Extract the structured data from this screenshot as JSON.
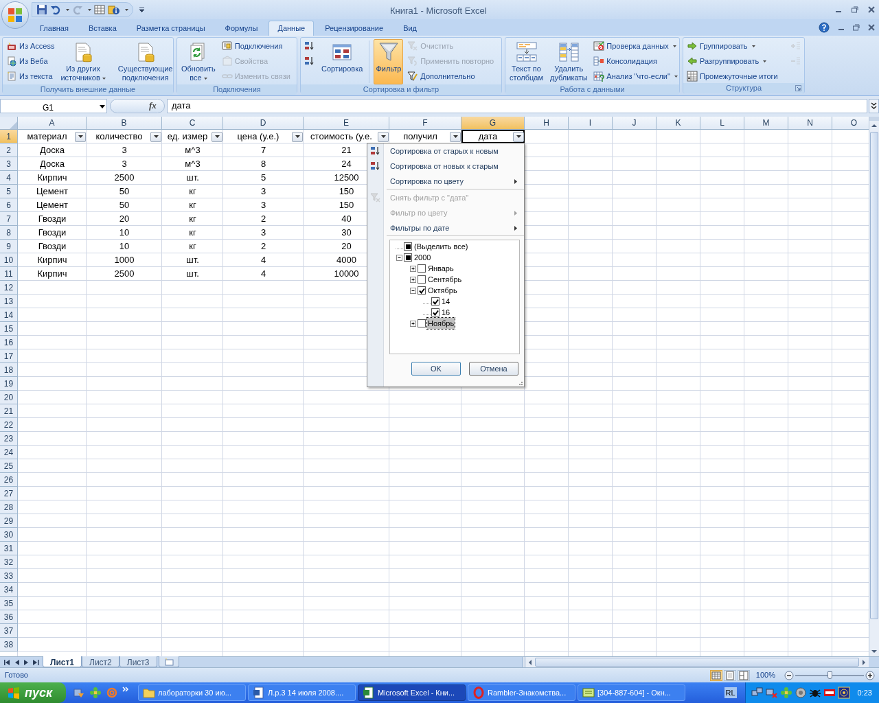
{
  "window": {
    "title": "Книга1 - Microsoft Excel"
  },
  "ribbon_tabs": [
    {
      "label": "Главная",
      "selected": false
    },
    {
      "label": "Вставка",
      "selected": false
    },
    {
      "label": "Разметка страницы",
      "selected": false
    },
    {
      "label": "Формулы",
      "selected": false
    },
    {
      "label": "Данные",
      "selected": true
    },
    {
      "label": "Рецензирование",
      "selected": false
    },
    {
      "label": "Вид",
      "selected": false
    }
  ],
  "ribbon_groups": [
    {
      "label": "Получить внешние данные",
      "launcher": false,
      "columns": [
        {
          "kind": "stack",
          "buttons": [
            {
              "label": "Из Access",
              "disabled": false,
              "dropdown": false
            },
            {
              "label": "Из Веба",
              "disabled": false,
              "dropdown": false
            },
            {
              "label": "Из текста",
              "disabled": false,
              "dropdown": false
            }
          ]
        },
        {
          "kind": "large",
          "label": "Из других\nисточников",
          "disabled": false,
          "dropdown": true,
          "on": false
        },
        {
          "kind": "separator"
        },
        {
          "kind": "large",
          "label": "Существующие\nподключения",
          "disabled": false,
          "dropdown": false,
          "on": false
        }
      ]
    },
    {
      "label": "Подключения",
      "launcher": false,
      "columns": [
        {
          "kind": "large",
          "label": "Обновить\nвсе",
          "disabled": false,
          "dropdown": true,
          "on": false
        },
        {
          "kind": "stack",
          "buttons": [
            {
              "label": "Подключения",
              "disabled": false,
              "dropdown": false
            },
            {
              "label": "Свойства",
              "disabled": true,
              "dropdown": false
            },
            {
              "label": "Изменить связи",
              "disabled": true,
              "dropdown": false
            }
          ]
        }
      ]
    },
    {
      "label": "Сортировка и фильтр",
      "launcher": false,
      "columns": [
        {
          "kind": "stack",
          "buttons": [
            {
              "disabled": false,
              "dropdown": false
            },
            {
              "disabled": false,
              "dropdown": false
            }
          ]
        },
        {
          "kind": "large",
          "label": "Сортировка",
          "disabled": false,
          "dropdown": false,
          "on": false
        },
        {
          "kind": "separator"
        },
        {
          "kind": "large",
          "label": "Фильтр",
          "disabled": false,
          "dropdown": false,
          "on": true
        },
        {
          "kind": "stack",
          "buttons": [
            {
              "label": "Очистить",
              "disabled": true,
              "dropdown": false
            },
            {
              "label": "Применить повторно",
              "disabled": true,
              "dropdown": false
            },
            {
              "label": "Дополнительно",
              "disabled": false,
              "dropdown": false
            }
          ]
        }
      ]
    },
    {
      "label": "Работа с данными",
      "launcher": false,
      "columns": [
        {
          "kind": "large",
          "label": "Текст по\nстолбцам",
          "disabled": false,
          "dropdown": false,
          "on": false
        },
        {
          "kind": "large",
          "label": "Удалить\nдубликаты",
          "disabled": false,
          "dropdown": false,
          "on": false
        },
        {
          "kind": "stack",
          "buttons": [
            {
              "label": "Проверка данных",
              "disabled": false,
              "dropdown": true
            },
            {
              "label": "Консолидация",
              "disabled": false,
              "dropdown": false
            },
            {
              "label": "Анализ \"что-если\"",
              "disabled": false,
              "dropdown": true
            }
          ]
        }
      ]
    },
    {
      "label": "Структура",
      "launcher": true,
      "columns": [
        {
          "kind": "stack",
          "buttons": [
            {
              "label": "Группировать",
              "disabled": false,
              "dropdown": true
            },
            {
              "label": "Разгруппировать",
              "disabled": false,
              "dropdown": true
            },
            {
              "label": "Промежуточные итоги",
              "disabled": false,
              "dropdown": false
            }
          ]
        },
        {
          "kind": "stack",
          "buttons": [
            {
              "disabled": true,
              "dropdown": false
            },
            {
              "disabled": true,
              "dropdown": false
            }
          ]
        }
      ]
    }
  ],
  "formula_bar": {
    "name_box": "G1",
    "function_label": "fx",
    "formula": "дата"
  },
  "sheet": {
    "columns": [
      {
        "label": "A",
        "selected": false
      },
      {
        "label": "B",
        "selected": false
      },
      {
        "label": "C",
        "selected": false
      },
      {
        "label": "D",
        "selected": false
      },
      {
        "label": "E",
        "selected": false
      },
      {
        "label": "F",
        "selected": false
      },
      {
        "label": "G",
        "selected": true
      },
      {
        "label": "H",
        "selected": false
      },
      {
        "label": "I",
        "selected": false
      },
      {
        "label": "J",
        "selected": false
      },
      {
        "label": "K",
        "selected": false
      },
      {
        "label": "L",
        "selected": false
      },
      {
        "label": "M",
        "selected": false
      },
      {
        "label": "N",
        "selected": false
      },
      {
        "label": "O",
        "selected": false
      }
    ],
    "rows": [
      {
        "label": "1",
        "selected": true
      },
      {
        "label": "2",
        "selected": false
      },
      {
        "label": "3",
        "selected": false
      },
      {
        "label": "4",
        "selected": false
      },
      {
        "label": "5",
        "selected": false
      },
      {
        "label": "6",
        "selected": false
      },
      {
        "label": "7",
        "selected": false
      },
      {
        "label": "8",
        "selected": false
      },
      {
        "label": "9",
        "selected": false
      },
      {
        "label": "10",
        "selected": false
      },
      {
        "label": "11",
        "selected": false
      },
      {
        "label": "12",
        "selected": false
      },
      {
        "label": "13",
        "selected": false
      },
      {
        "label": "14",
        "selected": false
      },
      {
        "label": "15",
        "selected": false
      },
      {
        "label": "16",
        "selected": false
      },
      {
        "label": "17",
        "selected": false
      },
      {
        "label": "18",
        "selected": false
      },
      {
        "label": "19",
        "selected": false
      },
      {
        "label": "20",
        "selected": false
      },
      {
        "label": "21",
        "selected": false
      },
      {
        "label": "22",
        "selected": false
      },
      {
        "label": "23",
        "selected": false
      },
      {
        "label": "24",
        "selected": false
      },
      {
        "label": "25",
        "selected": false
      },
      {
        "label": "26",
        "selected": false
      },
      {
        "label": "27",
        "selected": false
      },
      {
        "label": "28",
        "selected": false
      },
      {
        "label": "29",
        "selected": false
      },
      {
        "label": "30",
        "selected": false
      },
      {
        "label": "31",
        "selected": false
      },
      {
        "label": "32",
        "selected": false
      },
      {
        "label": "33",
        "selected": false
      },
      {
        "label": "34",
        "selected": false
      },
      {
        "label": "35",
        "selected": false
      },
      {
        "label": "36",
        "selected": false
      },
      {
        "label": "37",
        "selected": false
      },
      {
        "label": "38",
        "selected": false
      }
    ],
    "headers": [
      "материал",
      "количество",
      "ед. измер",
      "цена (у.е.)",
      "стоимость (у.е.",
      "получил",
      "дата"
    ],
    "data": [
      [
        "Доска",
        "3",
        "м^3",
        "7",
        "21"
      ],
      [
        "Доска",
        "3",
        "м^3",
        "8",
        "24"
      ],
      [
        "Кирпич",
        "2500",
        "шт.",
        "5",
        "12500"
      ],
      [
        "Цемент",
        "50",
        "кг",
        "3",
        "150"
      ],
      [
        "Цемент",
        "50",
        "кг",
        "3",
        "150"
      ],
      [
        "Гвозди",
        "20",
        "кг",
        "2",
        "40"
      ],
      [
        "Гвозди",
        "10",
        "кг",
        "3",
        "30"
      ],
      [
        "Гвозди",
        "10",
        "кг",
        "2",
        "20"
      ],
      [
        "Кирпич",
        "1000",
        "шт.",
        "4",
        "4000"
      ],
      [
        "Кирпич",
        "2500",
        "шт.",
        "4",
        "10000"
      ]
    ]
  },
  "filter_menu": {
    "sections": [
      [
        {
          "label": "Сортировка от старых к новым",
          "disabled": false,
          "submenu": false
        },
        {
          "label": "Сортировка от новых к старым",
          "disabled": false,
          "submenu": false
        },
        {
          "label": "Сортировка по цвету",
          "disabled": false,
          "submenu": true
        }
      ],
      [
        {
          "label": "Снять фильтр с \"дата\"",
          "disabled": true,
          "submenu": false
        },
        {
          "label": "Фильтр по цвету",
          "disabled": true,
          "submenu": true
        },
        {
          "label": "Фильтры по дате",
          "disabled": false,
          "submenu": true
        }
      ]
    ],
    "tree": [
      {
        "label": "(Выделить все)",
        "checked": false,
        "indeterminate": true,
        "selected": false
      },
      {
        "label": "2000",
        "checked": false,
        "indeterminate": true,
        "selected": false,
        "expanded": true,
        "children": [
          {
            "label": "Январь",
            "checked": false,
            "indeterminate": false,
            "selected": false,
            "expanded": false
          },
          {
            "label": "Сентябрь",
            "checked": false,
            "indeterminate": false,
            "selected": false,
            "expanded": false
          },
          {
            "label": "Октябрь",
            "checked": true,
            "indeterminate": false,
            "selected": false,
            "expanded": true,
            "children": [
              {
                "label": "14",
                "checked": true,
                "indeterminate": false,
                "selected": false
              },
              {
                "label": "16",
                "checked": true,
                "indeterminate": false,
                "selected": false
              }
            ]
          },
          {
            "label": "Ноябрь",
            "checked": false,
            "indeterminate": false,
            "selected": true,
            "expanded": false
          }
        ]
      }
    ],
    "buttons": [
      "OK",
      "Отмена"
    ]
  },
  "sheet_tabs": [
    {
      "label": "Лист1",
      "selected": true
    },
    {
      "label": "Лист2",
      "selected": false
    },
    {
      "label": "Лист3",
      "selected": false
    }
  ],
  "status_bar": {
    "text": "Готово",
    "view_buttons": [
      {
        "selected": true
      },
      {
        "selected": false
      },
      {
        "selected": false
      }
    ],
    "zoom": "100%",
    "zoom_slider": {
      "level": 0.5
    }
  },
  "taskbar": {
    "start": "пуск",
    "tasks": [
      {
        "label": "лабораторки 30 ию...",
        "selected": false
      },
      {
        "label": "Л.р.3 14 июля 2008....",
        "selected": false
      },
      {
        "label": "Microsoft Excel - Кни...",
        "selected": true
      },
      {
        "label": "Rambler-Знакомства...",
        "selected": false
      },
      {
        "label": "[304-887-604] - Окн...",
        "selected": false
      }
    ],
    "language": "RL",
    "clock": "0:23"
  }
}
